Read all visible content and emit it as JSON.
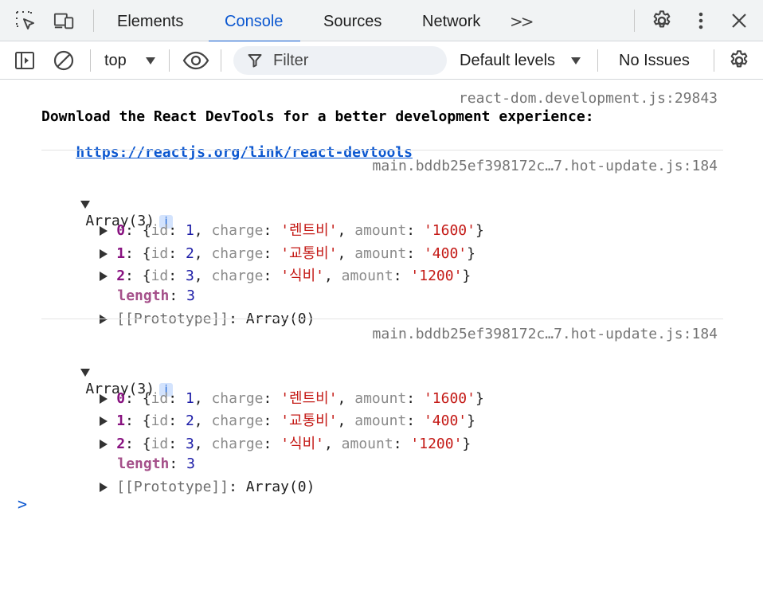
{
  "tabs": [
    {
      "label": "Elements"
    },
    {
      "label": "Console"
    },
    {
      "label": "Sources"
    },
    {
      "label": "Network"
    }
  ],
  "tabbar": {
    "more_tabs_label": ">>"
  },
  "toolbar": {
    "context": "top",
    "filter_placeholder": "Filter",
    "levels": "Default levels",
    "issues": "No Issues"
  },
  "messages": {
    "devtools": {
      "source": "react-dom.development.js:29843",
      "text": "Download the React DevTools for a better development experience:",
      "link": "https://reactjs.org/link/react-devtools"
    },
    "logs": [
      {
        "source": "main.bddb25ef398172c…7.hot-update.js:184",
        "summary": "Array(3)",
        "info_badge": "i",
        "items": [
          {
            "index": "0",
            "id": "1",
            "charge": "'렌트비'",
            "amount": "'1600'"
          },
          {
            "index": "1",
            "id": "2",
            "charge": "'교통비'",
            "amount": "'400'"
          },
          {
            "index": "2",
            "id": "3",
            "charge": "'식비'",
            "amount": "'1200'"
          }
        ],
        "length_key": "length",
        "length_value": "3",
        "proto_key": "[[Prototype]]",
        "proto_value": "Array(0)"
      },
      {
        "source": "main.bddb25ef398172c…7.hot-update.js:184",
        "summary": "Array(3)",
        "info_badge": "i",
        "items": [
          {
            "index": "0",
            "id": "1",
            "charge": "'렌트비'",
            "amount": "'1600'"
          },
          {
            "index": "1",
            "id": "2",
            "charge": "'교통비'",
            "amount": "'400'"
          },
          {
            "index": "2",
            "id": "3",
            "charge": "'식비'",
            "amount": "'1200'"
          }
        ],
        "length_key": "length",
        "length_value": "3",
        "proto_key": "[[Prototype]]",
        "proto_value": "Array(0)"
      }
    ]
  },
  "keys": {
    "id": "id",
    "charge": "charge",
    "amount": "amount"
  },
  "prompt": {
    "symbol": ">"
  },
  "colors": {
    "accent": "#0b57d0",
    "string": "#c41a16",
    "number": "#1a1aa6",
    "index_key": "#881280"
  }
}
